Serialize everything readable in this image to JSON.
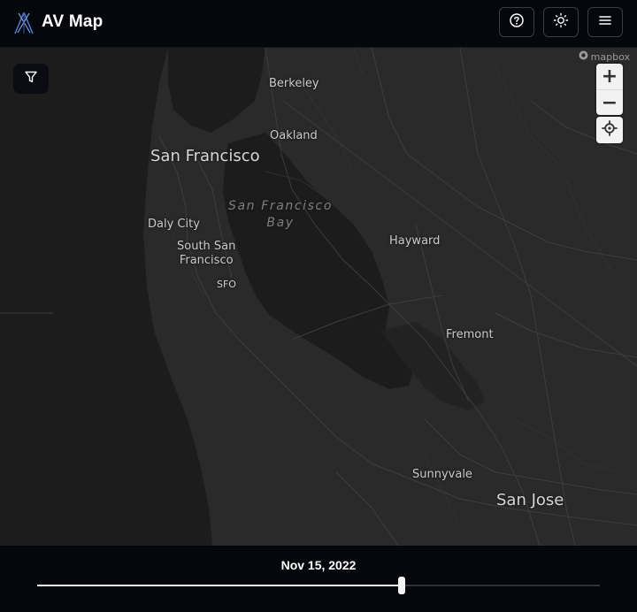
{
  "header": {
    "title": "AV Map",
    "buttons": [
      {
        "name": "help-button",
        "icon": "help-circle-icon"
      },
      {
        "name": "theme-toggle-button",
        "icon": "sun-icon"
      },
      {
        "name": "menu-button",
        "icon": "hamburger-menu-icon"
      }
    ]
  },
  "map": {
    "attribution": "mapbox",
    "labels": {
      "berkeley": "Berkeley",
      "oakland": "Oakland",
      "san_francisco": "San Francisco",
      "sf_bay_line1": "San Francisco",
      "sf_bay_line2": "Bay",
      "daly_city": "Daly City",
      "south_sf_line1": "South San",
      "south_sf_line2": "Francisco",
      "sfo": "SFO",
      "hayward": "Hayward",
      "fremont": "Fremont",
      "sunnyvale": "Sunnyvale",
      "san_jose": "San Jose"
    },
    "controls": {
      "zoom_in": "+",
      "zoom_out": "−"
    }
  },
  "timeline": {
    "date": "Nov 15, 2022",
    "progress_fraction": 0.648
  },
  "colors": {
    "chrome_background": "#05070d",
    "land": "#2a2a2a",
    "water": "#1b1b1b",
    "roads": "#3c3c3c"
  }
}
